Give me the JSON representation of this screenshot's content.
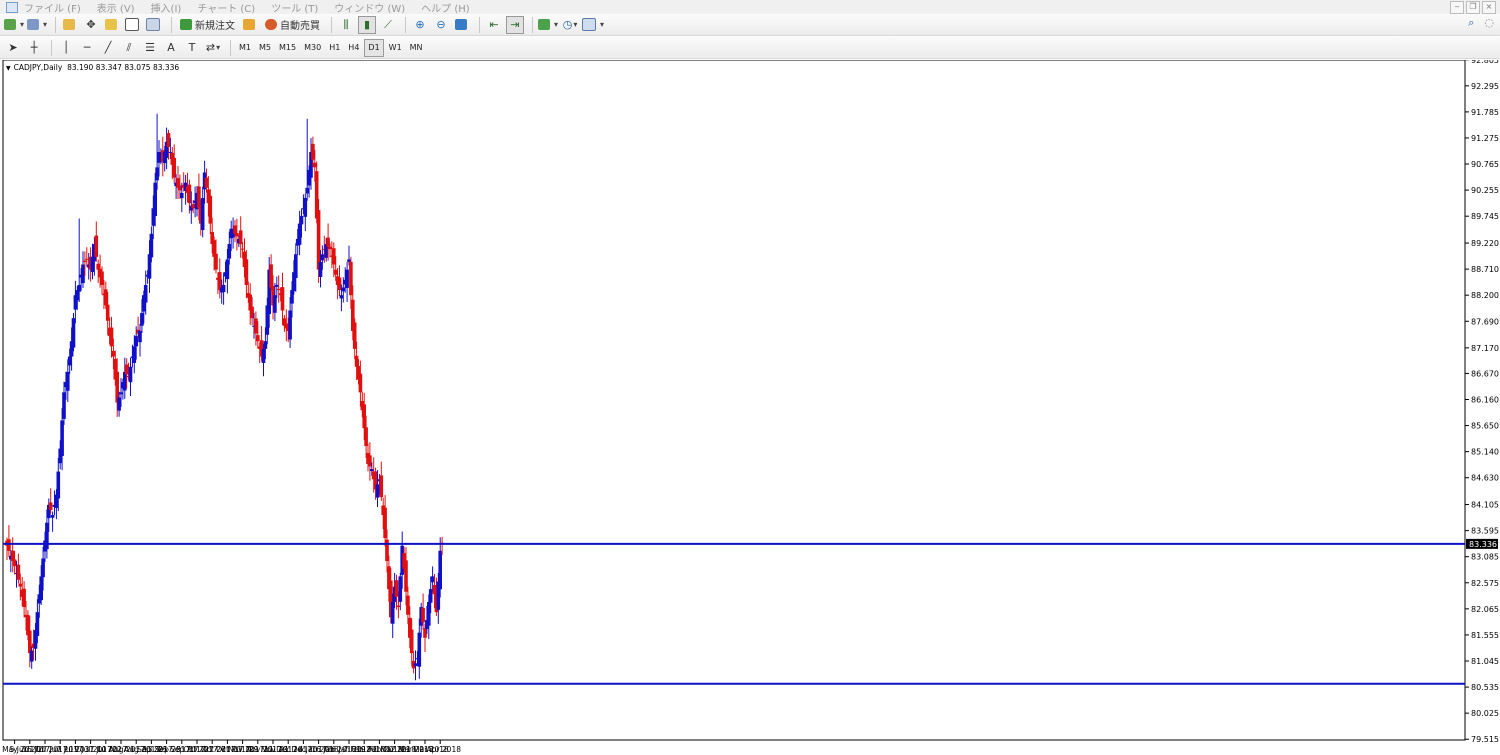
{
  "menu": [
    "ファイル (F)",
    "表示 (V)",
    "挿入(I)",
    "チャート (C)",
    "ツール (T)",
    "ウィンドウ (W)",
    "ヘルプ (H)"
  ],
  "toolbar": {
    "new_order_label": "新規注文",
    "auto_trade_label": "自動売買"
  },
  "timeframes": [
    "M1",
    "M5",
    "M15",
    "M30",
    "H1",
    "H4",
    "D1",
    "W1",
    "MN"
  ],
  "active_timeframe": "D1",
  "chart": {
    "symbol": "CADJPY,Daily",
    "ohlc": "83.190 83.347 83.075 83.336",
    "current_price": "83.336"
  },
  "colors": {
    "bull": "#1010c8",
    "bear": "#e01010",
    "hline": "#1010c8",
    "price_tag_bg": "#000000"
  },
  "chart_data": {
    "type": "candlestick",
    "y_range": [
      79.5,
      92.8
    ],
    "y_ticks": [
      92.805,
      92.295,
      91.785,
      91.275,
      90.765,
      90.255,
      89.745,
      89.22,
      88.71,
      88.2,
      87.69,
      87.17,
      86.67,
      86.16,
      85.65,
      85.14,
      84.63,
      84.105,
      83.595,
      83.085,
      82.575,
      82.065,
      81.555,
      81.045,
      80.535,
      80.025,
      79.515
    ],
    "x_labels": [
      {
        "label": "24 May 2017",
        "i": 4
      },
      {
        "label": "5 Jun 2017",
        "i": 12
      },
      {
        "label": "15 Jun 2017",
        "i": 20
      },
      {
        "label": "27 Jun 2017",
        "i": 28
      },
      {
        "label": "7 Jul 2017",
        "i": 36
      },
      {
        "label": "19 Jul 2017",
        "i": 44
      },
      {
        "label": "31 Jul 2017",
        "i": 52
      },
      {
        "label": "10 Aug 2017",
        "i": 60
      },
      {
        "label": "22 Aug 2017",
        "i": 68
      },
      {
        "label": "1 Sep 2017",
        "i": 76
      },
      {
        "label": "13 Sep 2017",
        "i": 84
      },
      {
        "label": "25 Sep 2017",
        "i": 92
      },
      {
        "label": "5 Oct 2017",
        "i": 100
      },
      {
        "label": "17 Oct 2017",
        "i": 108
      },
      {
        "label": "27 Oct 2017",
        "i": 116
      },
      {
        "label": "7 Nov 2017",
        "i": 124
      },
      {
        "label": "17 Nov 2017",
        "i": 132
      },
      {
        "label": "29 Nov 2017",
        "i": 140
      },
      {
        "label": "11 Dec 2017",
        "i": 148
      },
      {
        "label": "21 Dec 2017",
        "i": 156
      },
      {
        "label": "4 Jan 2018",
        "i": 164
      },
      {
        "label": "16 Jan 2018",
        "i": 172
      },
      {
        "label": "26 Jan 2018",
        "i": 180
      },
      {
        "label": "7 Feb 2018",
        "i": 188
      },
      {
        "label": "19 Feb 2018",
        "i": 196
      },
      {
        "label": "1 Mar 2018",
        "i": 204
      },
      {
        "label": "12 Mar 2018",
        "i": 212
      },
      {
        "label": "21 Mar 2018",
        "i": 220
      },
      {
        "label": "2 Apr 2018",
        "i": 228
      }
    ],
    "hlines": [
      83.336,
      80.6
    ],
    "anchors": [
      [
        0,
        83.3
      ],
      [
        4,
        82.9
      ],
      [
        7,
        82.5
      ],
      [
        10,
        81.9
      ],
      [
        12,
        81.2
      ],
      [
        14,
        81.3
      ],
      [
        16,
        82.0
      ],
      [
        18,
        82.7
      ],
      [
        20,
        83.4
      ],
      [
        22,
        84.1
      ],
      [
        24,
        83.9
      ],
      [
        26,
        84.3
      ],
      [
        28,
        85.2
      ],
      [
        30,
        86.3
      ],
      [
        32,
        86.7
      ],
      [
        34,
        87.3
      ],
      [
        36,
        88.2
      ],
      [
        38,
        88.4
      ],
      [
        40,
        88.8
      ],
      [
        42,
        88.9
      ],
      [
        44,
        88.7
      ],
      [
        46,
        89.2
      ],
      [
        48,
        88.7
      ],
      [
        50,
        88.4
      ],
      [
        52,
        88.0
      ],
      [
        54,
        87.4
      ],
      [
        56,
        87.0
      ],
      [
        58,
        86.1
      ],
      [
        60,
        86.3
      ],
      [
        62,
        86.7
      ],
      [
        64,
        86.6
      ],
      [
        66,
        87.0
      ],
      [
        68,
        87.4
      ],
      [
        70,
        87.5
      ],
      [
        72,
        88.2
      ],
      [
        74,
        88.6
      ],
      [
        76,
        89.4
      ],
      [
        78,
        90.4
      ],
      [
        80,
        91.0
      ],
      [
        82,
        90.8
      ],
      [
        84,
        91.2
      ],
      [
        86,
        91.0
      ],
      [
        88,
        90.5
      ],
      [
        90,
        90.3
      ],
      [
        92,
        90.2
      ],
      [
        94,
        90.4
      ],
      [
        96,
        90.0
      ],
      [
        98,
        89.9
      ],
      [
        100,
        90.2
      ],
      [
        102,
        89.6
      ],
      [
        104,
        90.6
      ],
      [
        106,
        90.0
      ],
      [
        108,
        89.2
      ],
      [
        110,
        88.7
      ],
      [
        112,
        88.3
      ],
      [
        114,
        88.4
      ],
      [
        116,
        88.9
      ],
      [
        118,
        89.5
      ],
      [
        120,
        89.4
      ],
      [
        122,
        89.3
      ],
      [
        124,
        89.1
      ],
      [
        126,
        88.4
      ],
      [
        128,
        87.9
      ],
      [
        130,
        87.6
      ],
      [
        132,
        87.3
      ],
      [
        134,
        87.0
      ],
      [
        136,
        87.3
      ],
      [
        138,
        88.7
      ],
      [
        140,
        88.0
      ],
      [
        142,
        88.4
      ],
      [
        144,
        88.2
      ],
      [
        146,
        87.6
      ],
      [
        148,
        87.5
      ],
      [
        150,
        88.3
      ],
      [
        152,
        89.0
      ],
      [
        154,
        89.6
      ],
      [
        156,
        89.9
      ],
      [
        158,
        90.3
      ],
      [
        160,
        91.0
      ],
      [
        162,
        90.7
      ],
      [
        164,
        88.7
      ],
      [
        166,
        89.0
      ],
      [
        168,
        89.2
      ],
      [
        170,
        89.1
      ],
      [
        172,
        88.8
      ],
      [
        174,
        88.4
      ],
      [
        176,
        88.2
      ],
      [
        178,
        88.5
      ],
      [
        180,
        88.9
      ],
      [
        182,
        87.5
      ],
      [
        184,
        86.8
      ],
      [
        186,
        86.3
      ],
      [
        188,
        85.6
      ],
      [
        190,
        84.9
      ],
      [
        192,
        84.8
      ],
      [
        194,
        84.4
      ],
      [
        196,
        84.6
      ],
      [
        198,
        83.9
      ],
      [
        200,
        83.0
      ],
      [
        202,
        81.9
      ],
      [
        204,
        82.5
      ],
      [
        206,
        82.1
      ],
      [
        208,
        83.3
      ],
      [
        210,
        82.4
      ],
      [
        212,
        81.5
      ],
      [
        214,
        80.9
      ],
      [
        216,
        81.1
      ],
      [
        218,
        82.1
      ],
      [
        220,
        81.5
      ],
      [
        222,
        82.2
      ],
      [
        224,
        82.7
      ],
      [
        226,
        82.0
      ],
      [
        228,
        83.2
      ],
      [
        229,
        83.336
      ]
    ],
    "spikes": {
      "79": 91.75,
      "158": 91.65,
      "38": 89.7,
      "66": 86.6
    }
  }
}
